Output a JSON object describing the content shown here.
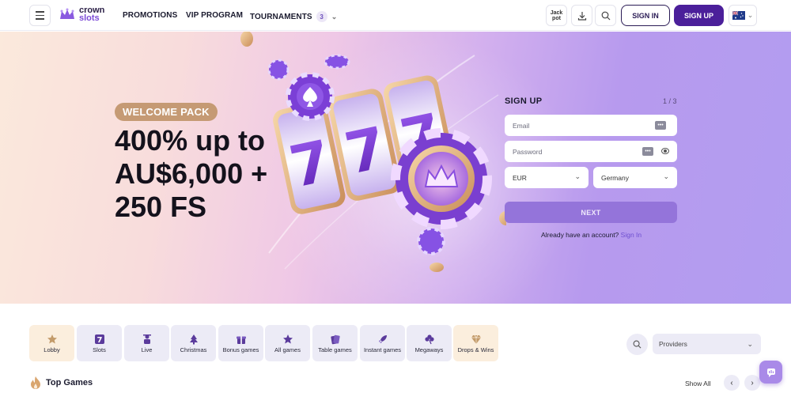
{
  "brand": {
    "line1": "crown",
    "line2": "slots"
  },
  "nav": {
    "promotions": "PROMOTIONS",
    "vip": "VIP PROGRAM",
    "tournaments": "TOURNAMENTS",
    "tournaments_count": "3"
  },
  "header": {
    "jackpot_line1": "Jack",
    "jackpot_line2": "pot",
    "signin": "SIGN IN",
    "signup": "SIGN UP"
  },
  "hero": {
    "badge": "WELCOME PACK",
    "title_line1": "400% up to",
    "title_line2": "AU$6,000 +",
    "title_line3": "250 FS"
  },
  "signup_form": {
    "title": "SIGN UP",
    "step": "1 / 3",
    "email_placeholder": "Email",
    "password_placeholder": "Password",
    "currency": "EUR",
    "country": "Germany",
    "next": "NEXT",
    "already_text": "Already have an account?",
    "signin_link": "Sign In"
  },
  "categories": [
    {
      "label": "Lobby",
      "icon": "star-icon"
    },
    {
      "label": "Slots",
      "icon": "seven-icon"
    },
    {
      "label": "Live",
      "icon": "dealer-icon"
    },
    {
      "label": "Christmas",
      "icon": "tree-icon"
    },
    {
      "label": "Bonus games",
      "icon": "gift-icon"
    },
    {
      "label": "All games",
      "icon": "star-icon"
    },
    {
      "label": "Table games",
      "icon": "cards-icon"
    },
    {
      "label": "Instant games",
      "icon": "rocket-icon"
    },
    {
      "label": "Megaways",
      "icon": "clover-icon"
    },
    {
      "label": "Drops & Wins",
      "icon": "diamond-icon"
    }
  ],
  "providers": {
    "label": "Providers"
  },
  "top_games": {
    "title": "Top Games",
    "show_all": "Show All"
  },
  "colors": {
    "accent": "#4b1f9a",
    "badge": "#c59a74",
    "next": "#9474da",
    "category_bg": "#ecebf6",
    "category_highlight": "#fbeedd"
  }
}
